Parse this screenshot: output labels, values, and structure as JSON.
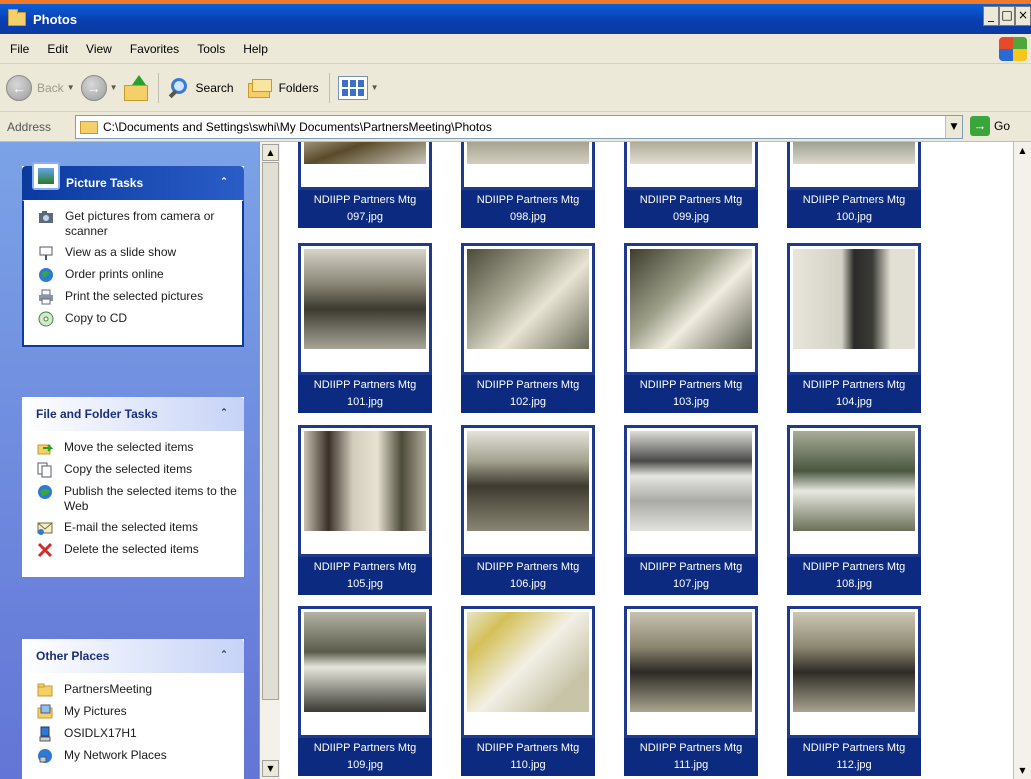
{
  "window": {
    "title": "Photos",
    "min_glyph": "_",
    "max_glyph": "□",
    "close_glyph": "×"
  },
  "menu": [
    "File",
    "Edit",
    "View",
    "Favorites",
    "Tools",
    "Help"
  ],
  "toolbar": {
    "back_label": "Back",
    "search_label": "Search",
    "folders_label": "Folders"
  },
  "address": {
    "label": "Address",
    "path": "C:\\Documents and Settings\\swhi\\My Documents\\PartnersMeeting\\Photos",
    "go_label": "Go"
  },
  "picture_tasks": {
    "title": "Picture Tasks",
    "items": [
      {
        "label": "Get pictures from camera or scanner",
        "icon": "camera-icon"
      },
      {
        "label": "View as a slide show",
        "icon": "slideshow-icon"
      },
      {
        "label": "Order prints online",
        "icon": "globe-icon"
      },
      {
        "label": "Print the selected pictures",
        "icon": "printer-icon"
      },
      {
        "label": "Copy to CD",
        "icon": "cd-icon"
      }
    ]
  },
  "file_folder_tasks": {
    "title": "File and Folder Tasks",
    "items": [
      {
        "label": "Move the selected items",
        "icon": "move-icon"
      },
      {
        "label": "Copy the selected items",
        "icon": "copy-icon"
      },
      {
        "label": "Publish the selected items to the Web",
        "icon": "publish-icon"
      },
      {
        "label": "E-mail the selected items",
        "icon": "email-icon"
      },
      {
        "label": "Delete the selected items",
        "icon": "delete-icon"
      }
    ]
  },
  "other_places": {
    "title": "Other Places",
    "items": [
      {
        "label": "PartnersMeeting",
        "icon": "folder-icon"
      },
      {
        "label": "My Pictures",
        "icon": "pictures-folder-icon"
      },
      {
        "label": "OSIDLX17H1",
        "icon": "computer-icon"
      },
      {
        "label": "My Network Places",
        "icon": "network-icon"
      }
    ]
  },
  "thumbnails": [
    {
      "line1": "NDIIPP Partners Mtg",
      "line2": "097.jpg"
    },
    {
      "line1": "NDIIPP Partners Mtg",
      "line2": "098.jpg"
    },
    {
      "line1": "NDIIPP Partners Mtg",
      "line2": "099.jpg"
    },
    {
      "line1": "NDIIPP Partners Mtg",
      "line2": "100.jpg"
    },
    {
      "line1": "NDIIPP Partners Mtg",
      "line2": "101.jpg"
    },
    {
      "line1": "NDIIPP Partners Mtg",
      "line2": "102.jpg"
    },
    {
      "line1": "NDIIPP Partners Mtg",
      "line2": "103.jpg"
    },
    {
      "line1": "NDIIPP Partners Mtg",
      "line2": "104.jpg"
    },
    {
      "line1": "NDIIPP Partners Mtg",
      "line2": "105.jpg"
    },
    {
      "line1": "NDIIPP Partners Mtg",
      "line2": "106.jpg"
    },
    {
      "line1": "NDIIPP Partners Mtg",
      "line2": "107.jpg"
    },
    {
      "line1": "NDIIPP Partners Mtg",
      "line2": "108.jpg"
    },
    {
      "line1": "NDIIPP Partners Mtg",
      "line2": "109.jpg"
    },
    {
      "line1": "NDIIPP Partners Mtg",
      "line2": "110.jpg"
    },
    {
      "line1": "NDIIPP Partners Mtg",
      "line2": "111.jpg"
    },
    {
      "line1": "NDIIPP Partners Mtg",
      "line2": "112.jpg"
    }
  ],
  "colors": {
    "title_bar": "#0a3fb0",
    "task_pane_bg": "#6a8ae0",
    "selection": "#0b2a80"
  }
}
